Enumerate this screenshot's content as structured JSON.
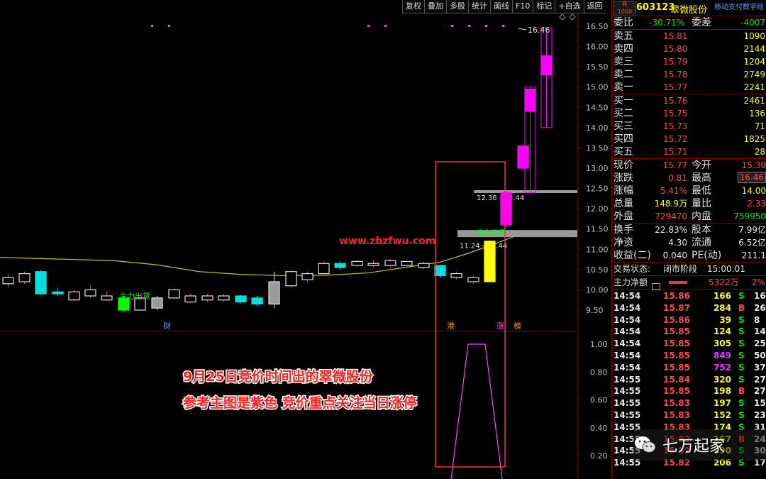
{
  "toolbar": {
    "items": [
      "复权",
      "叠加",
      "多股",
      "统计",
      "画线",
      "F10",
      "标记",
      "+自选",
      "返回"
    ]
  },
  "stock": {
    "code": "603123",
    "name": "翠微股份",
    "r_label": "R",
    "r_num": "1000",
    "ticker": "移动支付数字经"
  },
  "ratio": {
    "label1": "委比",
    "value1": "-30.71%",
    "label2": "委差",
    "value2": "-4007"
  },
  "asks": [
    {
      "label": "卖五",
      "price": "15.81",
      "vol": "1090"
    },
    {
      "label": "卖四",
      "price": "15.80",
      "vol": "2144"
    },
    {
      "label": "卖三",
      "price": "15.79",
      "vol": "1204"
    },
    {
      "label": "卖二",
      "price": "15.78",
      "vol": "2749"
    },
    {
      "label": "卖一",
      "price": "15.77",
      "vol": "2241"
    }
  ],
  "bids": [
    {
      "label": "买一",
      "price": "15.76",
      "vol": "2461"
    },
    {
      "label": "买二",
      "price": "15.75",
      "vol": "136"
    },
    {
      "label": "买三",
      "price": "15.73",
      "vol": "71"
    },
    {
      "label": "买四",
      "price": "15.72",
      "vol": "1825"
    },
    {
      "label": "买五",
      "price": "15.71",
      "vol": "28"
    }
  ],
  "quote": [
    {
      "l1": "现价",
      "v1": "15.77",
      "l2": "今开",
      "v2": "15.30",
      "c1": "red",
      "c2": "red"
    },
    {
      "l1": "涨跌",
      "v1": "0.81",
      "l2": "最高",
      "v2": "16.46",
      "c1": "red",
      "c2": "red",
      "hl2": true
    },
    {
      "l1": "涨幅",
      "v1": "5.41%",
      "l2": "最低",
      "v2": "14.00",
      "c1": "red",
      "c2": "yellow"
    },
    {
      "l1": "总量",
      "v1": "148.9万",
      "l2": "量比",
      "v2": "2.33",
      "c1": "yellow",
      "c2": "red"
    },
    {
      "l1": "外盘",
      "v1": "729470",
      "l2": "内盘",
      "v2": "759950",
      "c1": "red",
      "c2": "green"
    }
  ],
  "fund": [
    {
      "l1": "换手",
      "v1": "22.83%",
      "l2": "股本",
      "v2": "7.99亿"
    },
    {
      "l1": "净资",
      "v1": "4.30",
      "l2": "流通",
      "v2": "6.52亿"
    },
    {
      "l1": "收益(二)",
      "v1": "0.040",
      "l2": "PE(动)",
      "v2": "211.1"
    }
  ],
  "status": {
    "label": "交易状态:",
    "value": "闭市阶段",
    "time": "15:00:01"
  },
  "mainflow": {
    "label": "主力净额",
    "value": "5322万",
    "pct": "2%"
  },
  "trades": [
    {
      "t": "14:54",
      "p": "15.86",
      "v": "166",
      "s": "S",
      "n": "16",
      "pc": "red",
      "vc": "yellow",
      "sc": "green"
    },
    {
      "t": "14:54",
      "p": "15.87",
      "v": "284",
      "s": "B",
      "n": "26",
      "pc": "red",
      "vc": "yellow",
      "sc": "red"
    },
    {
      "t": "14:54",
      "p": "15.86",
      "v": "39",
      "s": "S",
      "n": "8",
      "pc": "red",
      "vc": "yellow",
      "sc": "green"
    },
    {
      "t": "14:54",
      "p": "15.85",
      "v": "124",
      "s": "S",
      "n": "14",
      "pc": "red",
      "vc": "yellow",
      "sc": "green"
    },
    {
      "t": "14:54",
      "p": "15.85",
      "v": "305",
      "s": "S",
      "n": "25",
      "pc": "red",
      "vc": "yellow",
      "sc": "green"
    },
    {
      "t": "14:54",
      "p": "15.85",
      "v": "849",
      "s": "S",
      "n": "50",
      "pc": "red",
      "vc": "purple",
      "sc": "green"
    },
    {
      "t": "14:54",
      "p": "15.85",
      "v": "752",
      "s": "S",
      "n": "37",
      "pc": "red",
      "vc": "purple",
      "sc": "green"
    },
    {
      "t": "14:55",
      "p": "15.84",
      "v": "320",
      "s": "S",
      "n": "27",
      "pc": "red",
      "vc": "yellow",
      "sc": "green"
    },
    {
      "t": "14:55",
      "p": "15.85",
      "v": "198",
      "s": "B",
      "n": "27",
      "pc": "red",
      "vc": "yellow",
      "sc": "red"
    },
    {
      "t": "14:55",
      "p": "15.83",
      "v": "197",
      "s": "S",
      "n": "15",
      "pc": "red",
      "vc": "yellow",
      "sc": "green"
    },
    {
      "t": "14:55",
      "p": "15.83",
      "v": "152",
      "s": "S",
      "n": "23",
      "pc": "red",
      "vc": "yellow",
      "sc": "green"
    },
    {
      "t": "14:55",
      "p": "15.83",
      "v": "174",
      "s": "S",
      "n": "31",
      "pc": "red",
      "vc": "yellow",
      "sc": "green"
    },
    {
      "t": "14:55",
      "p": "15.82",
      "v": "167",
      "s": "B",
      "n": "24",
      "pc": "red",
      "vc": "yellow",
      "sc": "red"
    },
    {
      "t": "14:55",
      "p": "15.82",
      "v": "190",
      "s": "S",
      "n": "30",
      "pc": "red",
      "vc": "yellow",
      "sc": "green"
    },
    {
      "t": "14:55",
      "p": "15.82",
      "v": "206",
      "s": "S",
      "n": "17",
      "pc": "red",
      "vc": "yellow",
      "sc": "green"
    }
  ],
  "chart": {
    "price_ticks": [
      "16.50",
      "16.00",
      "15.50",
      "15.00",
      "14.50",
      "14.00",
      "13.50",
      "13.00",
      "12.50",
      "12.00",
      "11.50",
      "11.00",
      "10.50",
      "10.00",
      "9.50"
    ],
    "sub_ticks": [
      "1.00",
      "0.80",
      "0.60",
      "0.40",
      "0.20"
    ],
    "high_label": "16.46",
    "zone_upper_label": "12.36 - 12.44",
    "zone_lower_label": "11.24 - 11.44",
    "signal_label": "主力出货",
    "signal_label2": "主力进场",
    "site_watermark": "www.zbzfwu.com",
    "marker_cai": "财",
    "marker_gang": "港",
    "marker_zhang": "涨",
    "marker_bang": "榜",
    "annotation_line1": "9月25日竞价时间出的翠微股份",
    "annotation_line2": "参考主图是紫色 竞价重点关注当日涨停",
    "colors": {
      "up": "#ff3030",
      "down": "#00e0e0",
      "limit": "#ff00ff",
      "yellow": "#ffff00",
      "green": "#00ff00"
    }
  },
  "watermark": {
    "text": "七万起家"
  },
  "chart_data": {
    "type": "candlestick",
    "ylim": [
      9.3,
      16.6
    ],
    "candles": [
      {
        "o": 10.15,
        "c": 10.3,
        "h": 10.4,
        "l": 10.05,
        "kind": "up"
      },
      {
        "o": 10.2,
        "c": 10.4,
        "h": 10.45,
        "l": 10.15,
        "kind": "up"
      },
      {
        "o": 10.45,
        "c": 9.9,
        "h": 10.5,
        "l": 9.88,
        "kind": "down"
      },
      {
        "o": 9.9,
        "c": 9.95,
        "h": 10.05,
        "l": 9.85,
        "kind": "down"
      },
      {
        "o": 9.95,
        "c": 9.75,
        "h": 10.0,
        "l": 9.72,
        "kind": "up"
      },
      {
        "o": 9.85,
        "c": 10.0,
        "h": 10.1,
        "l": 9.8,
        "kind": "up"
      },
      {
        "o": 9.85,
        "c": 9.75,
        "h": 9.95,
        "l": 9.72,
        "kind": "up"
      },
      {
        "o": 9.8,
        "c": 9.5,
        "h": 9.85,
        "l": 9.45,
        "kind": "green"
      },
      {
        "o": 9.5,
        "c": 9.8,
        "h": 9.85,
        "l": 9.48,
        "kind": "up"
      },
      {
        "o": 9.8,
        "c": 9.55,
        "h": 9.85,
        "l": 9.5,
        "kind": "upfill"
      },
      {
        "o": 9.8,
        "c": 10.0,
        "h": 10.05,
        "l": 9.75,
        "kind": "up"
      },
      {
        "o": 9.85,
        "c": 9.7,
        "h": 9.9,
        "l": 9.68,
        "kind": "up"
      },
      {
        "o": 9.85,
        "c": 9.75,
        "h": 9.9,
        "l": 9.7,
        "kind": "up"
      },
      {
        "o": 9.85,
        "c": 9.75,
        "h": 9.9,
        "l": 9.7,
        "kind": "up"
      },
      {
        "o": 9.85,
        "c": 9.7,
        "h": 9.88,
        "l": 9.66,
        "kind": "down"
      },
      {
        "o": 9.8,
        "c": 9.65,
        "h": 9.85,
        "l": 9.6,
        "kind": "down"
      },
      {
        "o": 9.65,
        "c": 10.2,
        "h": 10.45,
        "l": 9.55,
        "kind": "upfill"
      },
      {
        "o": 10.1,
        "c": 10.45,
        "h": 10.48,
        "l": 10.05,
        "kind": "up"
      },
      {
        "o": 10.25,
        "c": 10.4,
        "h": 10.45,
        "l": 10.2,
        "kind": "up"
      },
      {
        "o": 10.4,
        "c": 10.65,
        "h": 10.7,
        "l": 10.35,
        "kind": "up"
      },
      {
        "o": 10.55,
        "c": 10.65,
        "h": 10.7,
        "l": 10.5,
        "kind": "down"
      },
      {
        "o": 10.6,
        "c": 10.7,
        "h": 10.75,
        "l": 10.55,
        "kind": "up"
      },
      {
        "o": 10.65,
        "c": 10.6,
        "h": 10.72,
        "l": 10.55,
        "kind": "up"
      },
      {
        "o": 10.6,
        "c": 10.72,
        "h": 10.75,
        "l": 10.55,
        "kind": "up"
      },
      {
        "o": 10.7,
        "c": 10.6,
        "h": 10.72,
        "l": 10.55,
        "kind": "up"
      },
      {
        "o": 10.65,
        "c": 10.55,
        "h": 10.7,
        "l": 10.5,
        "kind": "up"
      },
      {
        "o": 10.6,
        "c": 10.35,
        "h": 10.62,
        "l": 10.3,
        "kind": "down"
      },
      {
        "o": 10.4,
        "c": 10.3,
        "h": 10.45,
        "l": 10.25,
        "kind": "up"
      },
      {
        "o": 10.3,
        "c": 10.2,
        "h": 10.35,
        "l": 10.15,
        "kind": "up"
      },
      {
        "o": 10.2,
        "c": 11.2,
        "h": 11.22,
        "l": 10.2,
        "kind": "yellow"
      },
      {
        "o": 11.6,
        "c": 12.4,
        "h": 12.44,
        "l": 11.55,
        "kind": "limit"
      },
      {
        "o": 13.0,
        "c": 13.55,
        "h": 13.6,
        "l": 12.95,
        "kind": "limit"
      },
      {
        "o": 14.4,
        "c": 14.95,
        "h": 15.0,
        "l": 12.4,
        "kind": "limitout"
      },
      {
        "o": 15.3,
        "c": 15.77,
        "h": 16.46,
        "l": 14.0,
        "kind": "limitout"
      }
    ]
  }
}
